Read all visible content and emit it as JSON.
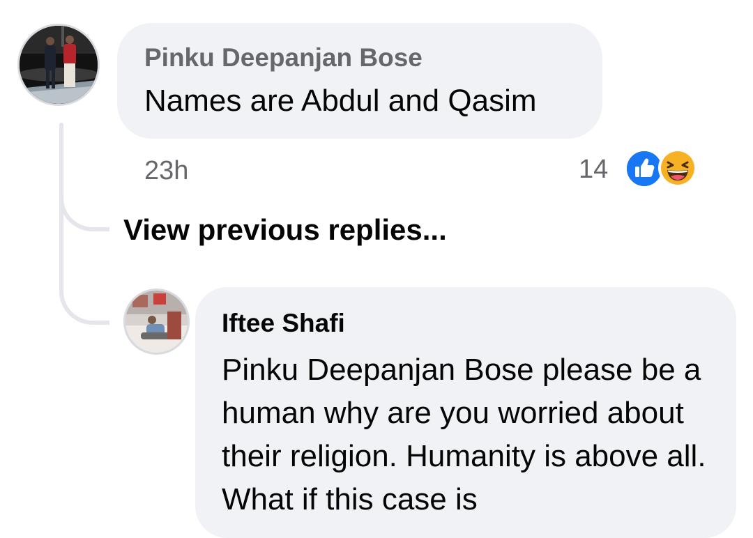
{
  "comment": {
    "author": "Pinku Deepanjan Bose",
    "text": "Names are Abdul and Qasim",
    "time": "23h",
    "reaction_count": "14",
    "reactions": [
      "like-icon",
      "haha-icon"
    ]
  },
  "view_previous_replies": "View previous replies...",
  "reply": {
    "author": "Iftee Shafi",
    "text": "Pinku Deepanjan Bose please be a human why are you worried about their religion. Humanity is above all. What if this case is"
  },
  "colors": {
    "bubble": "#f0f2f5",
    "meta_text": "#65676b",
    "like_blue": "#1877f2",
    "haha_yellow": "#f7b125",
    "thread_line": "#e4e6eb"
  }
}
